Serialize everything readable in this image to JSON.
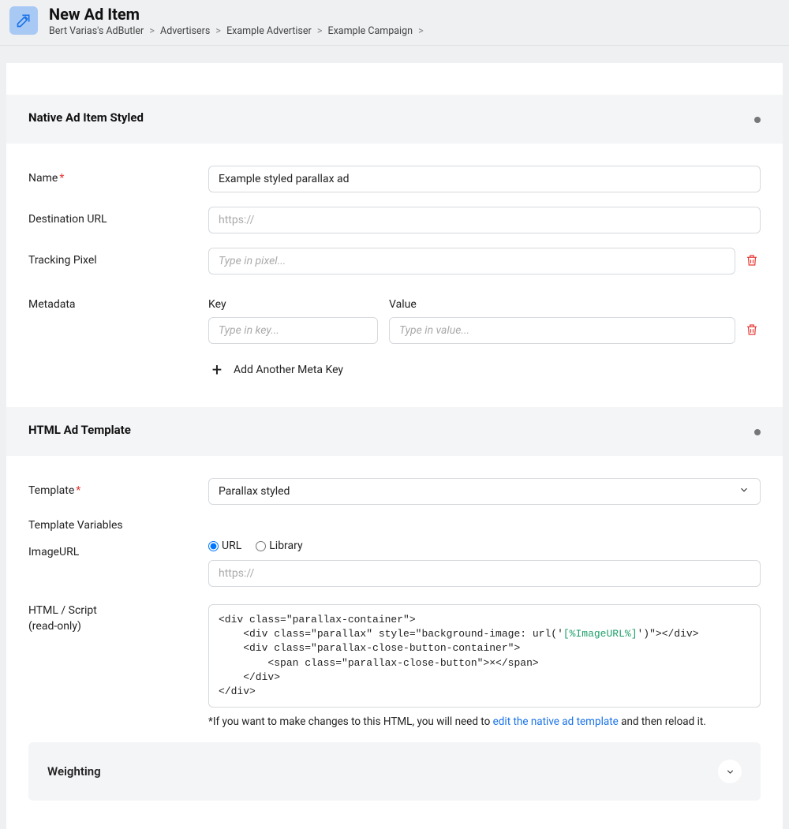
{
  "header": {
    "title": "New Ad Item",
    "breadcrumb": [
      "Bert Varias's AdButler",
      "Advertisers",
      "Example Advertiser",
      "Example Campaign"
    ]
  },
  "sections": {
    "native": {
      "title": "Native Ad Item Styled",
      "fields": {
        "name_label": "Name",
        "name_value": "Example styled parallax ad",
        "dest_label": "Destination URL",
        "dest_placeholder": "https://",
        "pixel_label": "Tracking Pixel",
        "pixel_placeholder": "Type in pixel...",
        "metadata_label": "Metadata",
        "meta_key_heading": "Key",
        "meta_value_heading": "Value",
        "meta_key_placeholder": "Type in key...",
        "meta_value_placeholder": "Type in value...",
        "add_meta_label": "Add Another Meta Key"
      }
    },
    "template": {
      "title": "HTML Ad Template",
      "template_label": "Template",
      "template_value": "Parallax styled",
      "template_vars_heading": "Template Variables",
      "imageurl_label": "ImageURL",
      "radio_url": "URL",
      "radio_library": "Library",
      "imageurl_placeholder": "https://",
      "html_label": "HTML / Script",
      "html_readonly": "(read-only)",
      "html_code_parts": {
        "l1": "<div class=\"parallax-container\">",
        "l2a": "    <div class=\"parallax\" style=\"background-image: url('",
        "l2var": "[%ImageURL%]",
        "l2b": "')\"></div>",
        "l3": "    <div class=\"parallax-close-button-container\">",
        "l4": "        <span class=\"parallax-close-button\">×</span>",
        "l5": "    </div>",
        "l6": "</div>"
      },
      "note_prefix": "*If you want to make changes to this HTML, you will need to ",
      "note_link": "edit the native ad template",
      "note_suffix": " and then reload it."
    },
    "weighting": {
      "title": "Weighting"
    }
  }
}
